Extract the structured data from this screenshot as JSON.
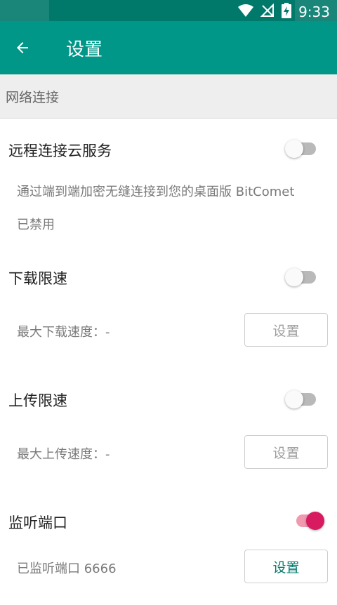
{
  "status_bar": {
    "time": "9:33"
  },
  "app_bar": {
    "title": "设置"
  },
  "section": {
    "title": "网络连接"
  },
  "settings": {
    "remote": {
      "title": "远程连接云服务",
      "description": "通过端到端加密无缝连接到您的桌面版 BitComet",
      "status": "已禁用",
      "enabled": false
    },
    "download_limit": {
      "title": "下载限速",
      "detail": "最大下载速度：-",
      "button": "设置",
      "enabled": false
    },
    "upload_limit": {
      "title": "上传限速",
      "detail": "最大上传速度：-",
      "button": "设置",
      "enabled": false
    },
    "listen_port": {
      "title": "监听端口",
      "detail": "已监听端口 6666",
      "button": "设置",
      "enabled": true
    }
  },
  "colors": {
    "primary": "#009688",
    "primary_dark": "#00796b",
    "accent": "#d81b60"
  }
}
